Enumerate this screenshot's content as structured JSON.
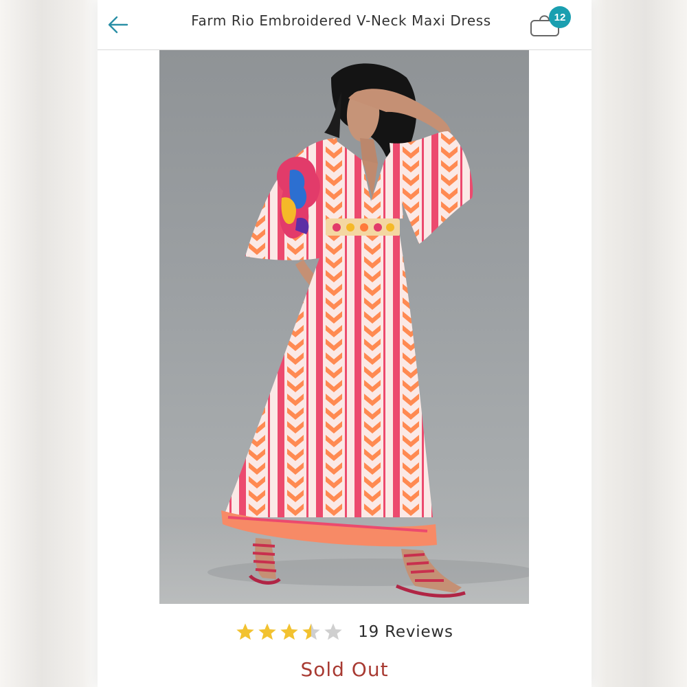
{
  "header": {
    "title": "Farm Rio Embroidered V-Neck Maxi Dress",
    "back_icon": "arrow-left-icon",
    "bag_icon": "shopping-bag-icon",
    "bag_count": "12"
  },
  "product": {
    "image_alt": "Model wearing pink and orange embroidered v-neck maxi dress",
    "rating": 3.5,
    "rating_max": 5,
    "reviews_label": "19 Reviews",
    "status": "Sold Out"
  },
  "colors": {
    "accent": "#1a9fb0",
    "star_filled": "#f2c230",
    "star_empty": "#cfcfcf",
    "sold_out": "#a83a32"
  }
}
